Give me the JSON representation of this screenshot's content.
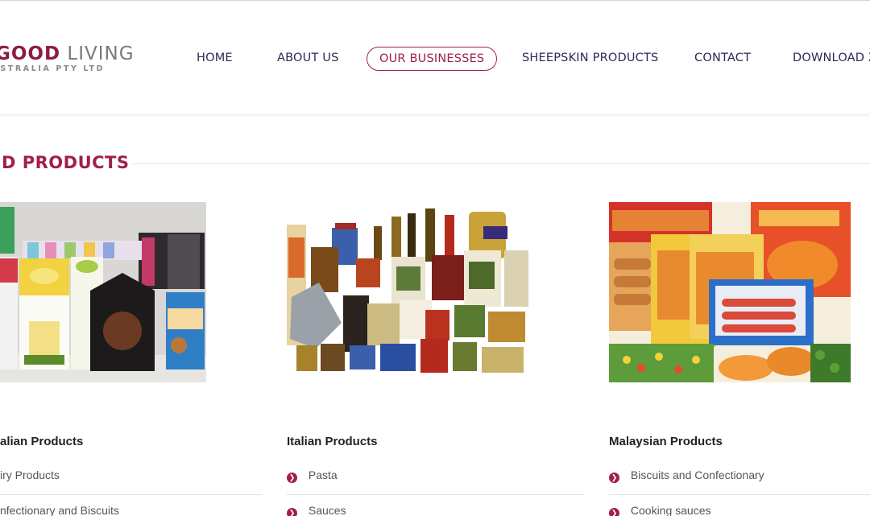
{
  "logo": {
    "part1": "GOOD",
    "part2": "LIVING",
    "subtitle": "USTRALIA PTY LTD"
  },
  "nav": {
    "items": [
      {
        "label": "HOME",
        "active": false
      },
      {
        "label": "ABOUT US",
        "active": false
      },
      {
        "label": "OUR BUSINESSES",
        "active": true
      },
      {
        "label": "SHEEPSKIN PRODUCTS",
        "active": false
      },
      {
        "label": "CONTACT",
        "active": false
      },
      {
        "label": "DOWNLOAD Z",
        "active": false
      }
    ]
  },
  "section": {
    "title": "D PRODUCTS"
  },
  "cards": [
    {
      "title": "alian Products",
      "items": [
        "iry Products",
        "nfectionary and Biscuits"
      ]
    },
    {
      "title": "Italian Products",
      "items": [
        "Pasta",
        "Sauces"
      ]
    },
    {
      "title": "Malaysian Products",
      "items": [
        "Biscuits and Confectionary",
        "Cooking sauces"
      ]
    }
  ],
  "colors": {
    "accent": "#a01f4e",
    "nav_text": "#2b2a55"
  },
  "icons": {
    "bullet": "chevron-right-circle-icon"
  }
}
